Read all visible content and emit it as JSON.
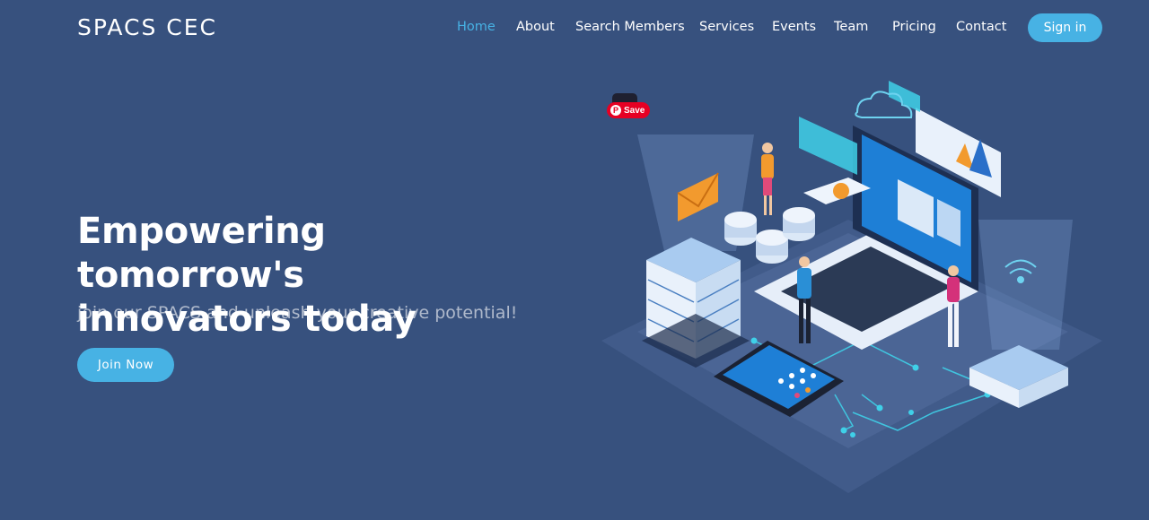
{
  "header": {
    "logo": "SPACS CEC",
    "nav": [
      {
        "label": "Home",
        "active": true
      },
      {
        "label": "About",
        "active": false
      },
      {
        "label": "Search Members",
        "active": false
      },
      {
        "label": "Services",
        "active": false
      },
      {
        "label": "Events",
        "active": false
      },
      {
        "label": "Team",
        "active": false
      },
      {
        "label": "Pricing",
        "active": false
      },
      {
        "label": "Contact",
        "active": false
      }
    ],
    "signin_label": "Sign in"
  },
  "hero": {
    "title_line1": "Empowering tomorrow's",
    "title_line2": "innovators today",
    "subtitle": "join our SPACS and unleash your creative potential!",
    "cta_label": "Join Now"
  },
  "pinterest": {
    "save_label": "Save"
  },
  "colors": {
    "background": "#37517e",
    "accent": "#47b2e4",
    "pinterest": "#e60023"
  }
}
